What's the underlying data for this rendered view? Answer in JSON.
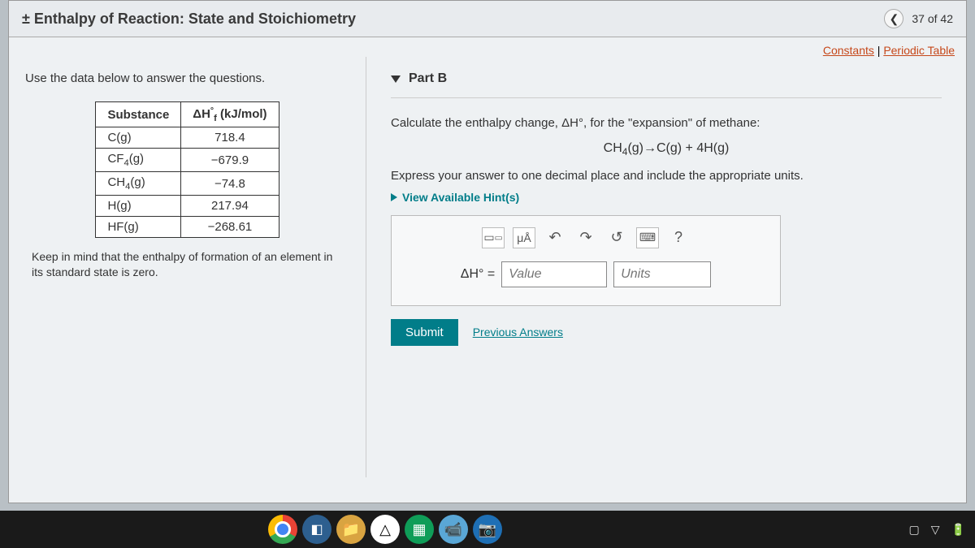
{
  "header": {
    "title_prefix": "±",
    "title": "Enthalpy of Reaction: State and Stoichiometry",
    "progress": "37 of 42"
  },
  "links": {
    "constants": "Constants",
    "periodic": "Periodic Table"
  },
  "left": {
    "instructions": "Use the data below to answer the questions.",
    "table": {
      "h_substance": "Substance",
      "h_value": "ΔH°f (kJ/mol)",
      "rows": [
        {
          "sub": "C(g)",
          "val": "718.4"
        },
        {
          "sub": "CF4(g)",
          "sub_html": "CF<sub>4</sub>(g)",
          "val": "−679.9"
        },
        {
          "sub": "CH4(g)",
          "sub_html": "CH<sub>4</sub>(g)",
          "val": "−74.8"
        },
        {
          "sub": "H(g)",
          "val": "217.94"
        },
        {
          "sub": "HF(g)",
          "val": "−268.61"
        }
      ]
    },
    "note": "Keep in mind that the enthalpy of formation of an element in its standard state is zero."
  },
  "right": {
    "part_label": "Part B",
    "prompt_pre": "Calculate the enthalpy change, ",
    "prompt_sym": "ΔH°",
    "prompt_post": ", for the \"expansion\" of methane:",
    "reaction": "CH4(g) → C(g) + 4H(g)",
    "express": "Express your answer to one decimal place and include the appropriate units.",
    "hint": "View Available Hint(s)",
    "toolbar": {
      "frac_tip": "fraction-template",
      "mu": "μÅ",
      "undo": "↶",
      "redo": "↷",
      "reset": "↺",
      "keyboard": "⌨",
      "help": "?"
    },
    "dh_label": "ΔH° =",
    "value_placeholder": "Value",
    "units_placeholder": "Units",
    "submit": "Submit",
    "prev": "Previous Answers"
  },
  "taskbar": {
    "tray": [
      "▢",
      "▽",
      "🔋"
    ]
  }
}
